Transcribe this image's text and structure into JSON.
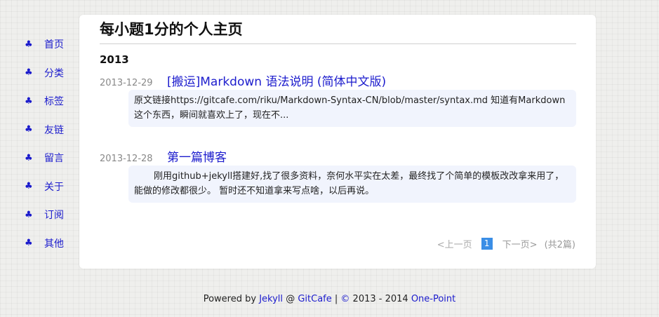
{
  "sidebar": {
    "items": [
      {
        "icon": "club-icon",
        "glyph": "♣",
        "label": "首页"
      },
      {
        "icon": "club-icon",
        "glyph": "♣",
        "label": "分类"
      },
      {
        "icon": "club-icon",
        "glyph": "♣",
        "label": "标签"
      },
      {
        "icon": "club-icon",
        "glyph": "♣",
        "label": "友链"
      },
      {
        "icon": "club-icon",
        "glyph": "♣",
        "label": "留言"
      },
      {
        "icon": "club-icon",
        "glyph": "♣",
        "label": "关于"
      },
      {
        "icon": "club-icon",
        "glyph": "♣",
        "label": "订阅"
      },
      {
        "icon": "club-icon",
        "glyph": "♣",
        "label": "其他"
      }
    ]
  },
  "main": {
    "title": "每小题1分的个人主页",
    "year": "2013",
    "posts": [
      {
        "date": "2013-12-29",
        "title": "[搬运]Markdown 语法说明 (简体中文版)",
        "excerpt": "原文链接https://gitcafe.com/riku/Markdown-Syntax-CN/blob/master/syntax.md 知道有Markdown这个东西，瞬间就喜欢上了，现在不..."
      },
      {
        "date": "2013-12-28",
        "title": "第一篇博客",
        "excerpt": "刚用github+jekyll搭建好,找了很多资料，奈何水平实在太差，最终找了个简单的模板改改拿来用了，能做的修改都很少。         暂时还不知道拿来写点啥，以后再说。"
      }
    ],
    "pagination": {
      "prev": "<上一页",
      "current": "1",
      "next": "下一页>",
      "total": "(共2篇)"
    }
  },
  "footer": {
    "powered_by": "Powered by",
    "jekyll": "Jekyll",
    "at": "@",
    "gitcafe": "GitCafe",
    "sep": "|",
    "copyright_symbol": "©",
    "years": "2013 - 2014",
    "theme": "One-Point"
  },
  "colors": {
    "link": "#1c1ccd",
    "pager_active": "#3a8ee6",
    "excerpt_bg": "#f1f4fd"
  }
}
